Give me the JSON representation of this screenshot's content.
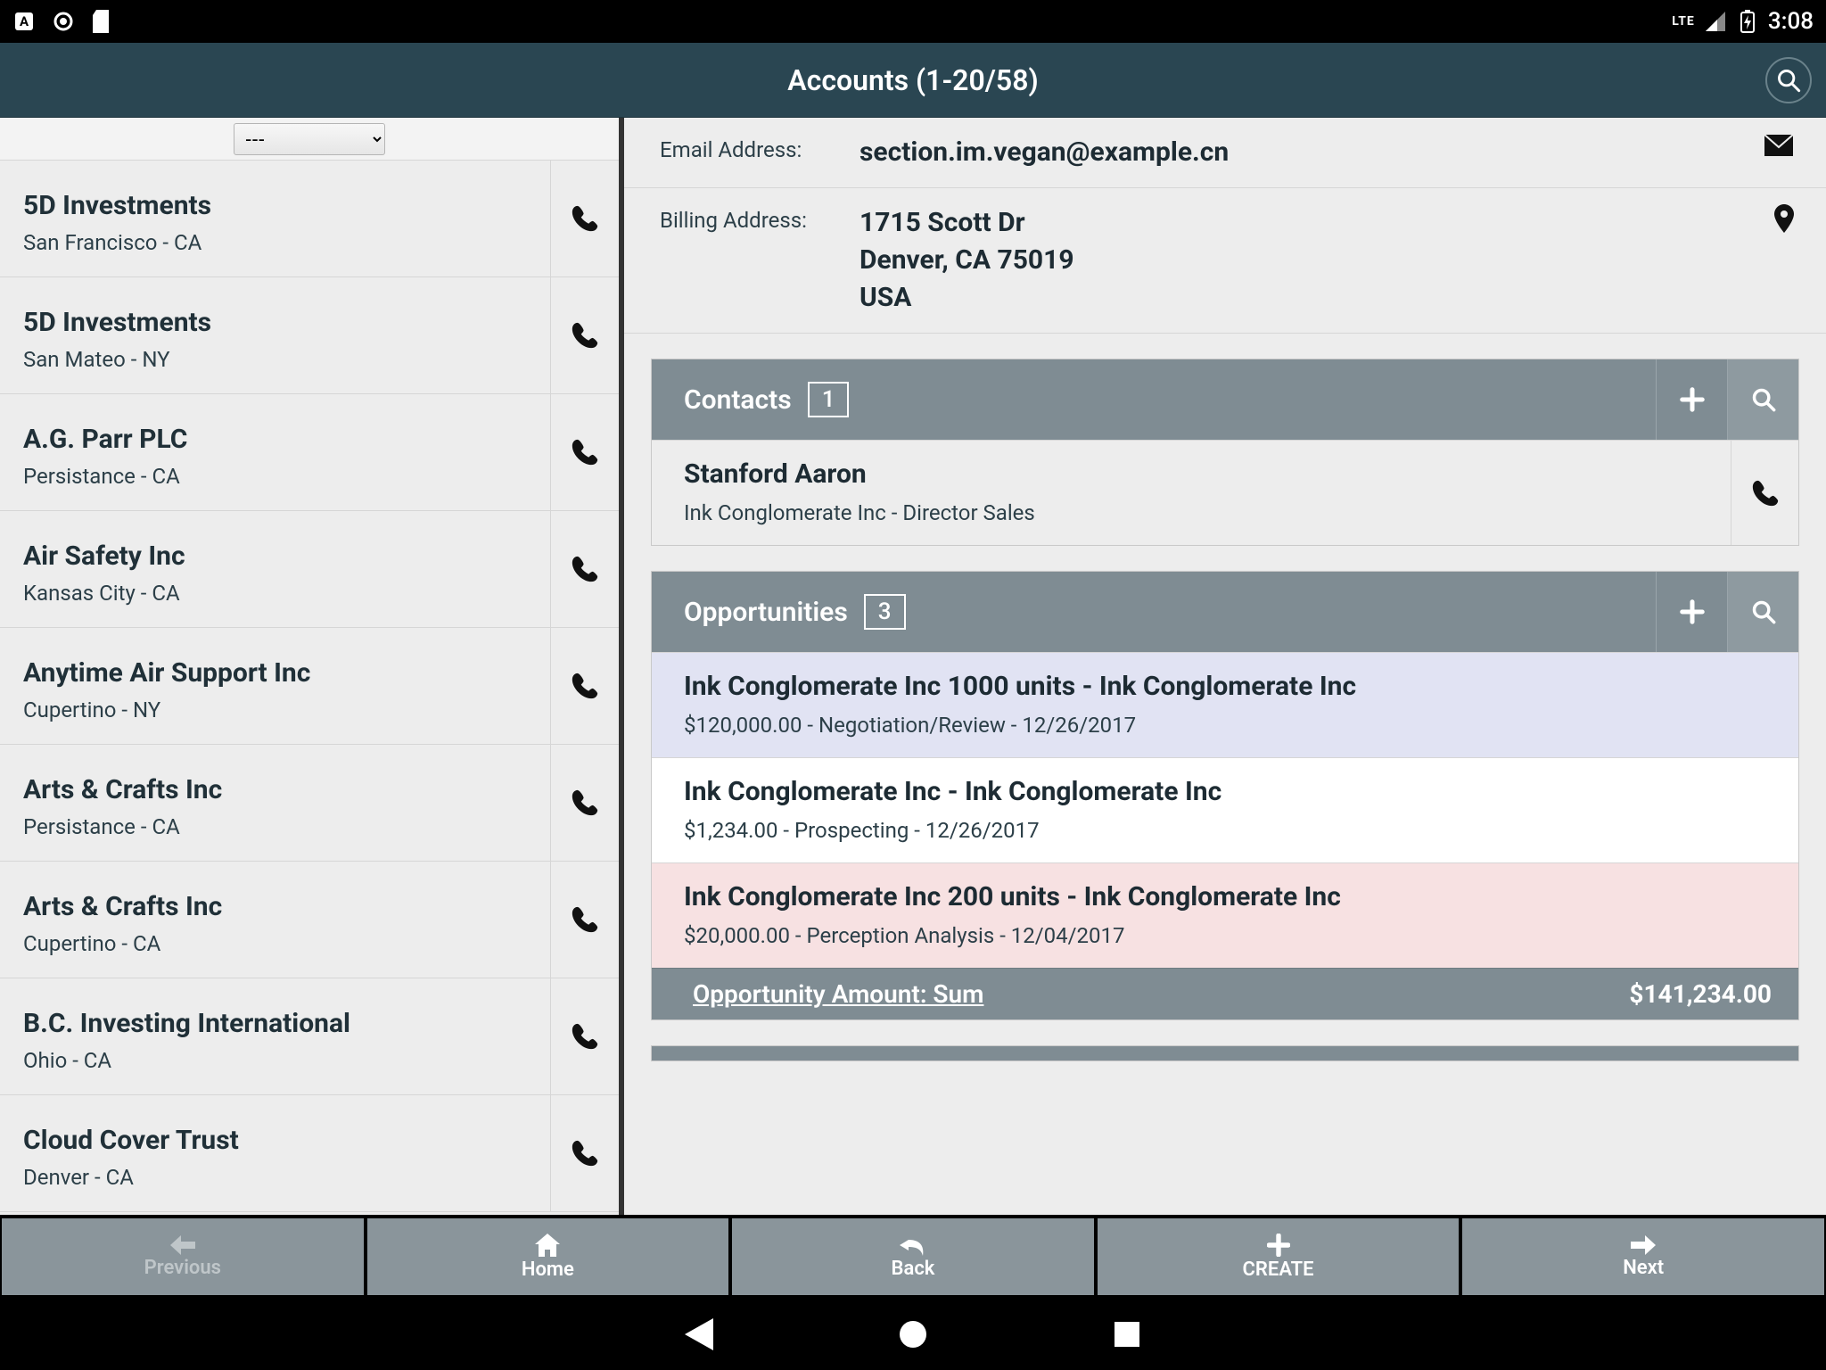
{
  "status": {
    "time": "3:08",
    "network": "LTE"
  },
  "header": {
    "title": "Accounts (1-20/58)"
  },
  "sidebar": {
    "filter_selected": "---",
    "items": [
      {
        "name": "5D Investments",
        "loc": "San Francisco - CA"
      },
      {
        "name": "5D Investments",
        "loc": "San Mateo - NY"
      },
      {
        "name": "A.G. Parr PLC",
        "loc": "Persistance - CA"
      },
      {
        "name": "Air Safety Inc",
        "loc": "Kansas City - CA"
      },
      {
        "name": "Anytime Air Support Inc",
        "loc": "Cupertino - NY"
      },
      {
        "name": "Arts & Crafts Inc",
        "loc": "Persistance - CA"
      },
      {
        "name": "Arts & Crafts Inc",
        "loc": "Cupertino - CA"
      },
      {
        "name": "B.C. Investing International",
        "loc": "Ohio - CA"
      },
      {
        "name": "Cloud Cover Trust",
        "loc": "Denver - CA"
      }
    ]
  },
  "detail": {
    "email_label": "Email Address:",
    "email_value": "section.im.vegan@example.cn",
    "billing_label": "Billing Address:",
    "billing_value": "1715 Scott Dr\nDenver, CA 75019\nUSA",
    "contacts": {
      "title": "Contacts",
      "count": "1",
      "items": [
        {
          "name": "Stanford Aaron",
          "sub": "Ink Conglomerate Inc - Director Sales"
        }
      ]
    },
    "opportunities": {
      "title": "Opportunities",
      "count": "3",
      "items": [
        {
          "title": "Ink Conglomerate Inc 1000 units - Ink Conglomerate Inc",
          "sub": "$120,000.00 - Negotiation/Review - 12/26/2017",
          "tone": "opp-purple"
        },
        {
          "title": "Ink Conglomerate Inc - Ink Conglomerate Inc",
          "sub": "$1,234.00 - Prospecting - 12/26/2017",
          "tone": "opp-white"
        },
        {
          "title": "Ink Conglomerate Inc 200 units - Ink Conglomerate Inc",
          "sub": "$20,000.00 - Perception Analysis - 12/04/2017",
          "tone": "opp-pink"
        }
      ],
      "sum_label": "Opportunity Amount: Sum",
      "sum_value": "$141,234.00"
    }
  },
  "toolbar": {
    "previous": "Previous",
    "home": "Home",
    "back": "Back",
    "create": "CREATE",
    "next": "Next"
  }
}
